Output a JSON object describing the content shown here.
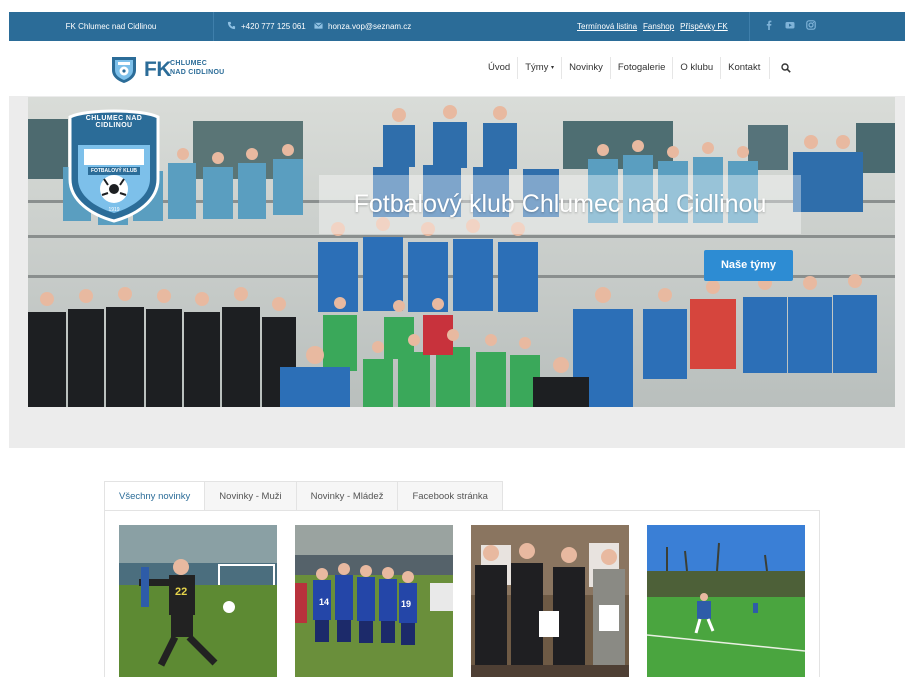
{
  "topbar": {
    "club": "FK Chlumec nad Cidlinou",
    "phone": "+420 777 125 061",
    "email": "honza.vop@seznam.cz",
    "links": [
      "Termínová listina",
      "Fanshop",
      "Příspěvky FK"
    ],
    "social_icons": [
      "facebook-icon",
      "youtube-icon",
      "instagram-icon"
    ]
  },
  "header": {
    "logo_fk": "FK",
    "logo_line1": "CHLUMEC",
    "logo_line2": "NAD CIDLINOU",
    "nav": [
      "Úvod",
      "Týmy",
      "Novinky",
      "Fotogalerie",
      "O klubu",
      "Kontakt"
    ],
    "nav_caret": "▾"
  },
  "hero": {
    "crest_top": "CHLUMEC NAD CIDLINOU",
    "crest_banner": "FOTBALOVÝ KLUB",
    "crest_year": "1919",
    "title": "Fotbalový klub Chlumec nad Cidlinou",
    "button": "Naše týmy"
  },
  "tabs": {
    "items": [
      "Všechny novinky",
      "Novinky - Muži",
      "Novinky - Mládež",
      "Facebook stránka"
    ],
    "active": "Všechny novinky"
  },
  "news_photos": [
    "goalkeeper-photo",
    "team-huddle-photo",
    "award-ceremony-photo",
    "match-field-photo"
  ],
  "colors": {
    "brand_blue": "#2b6c98",
    "button_blue": "#2d8cd3",
    "hero_background": "#ececec"
  }
}
